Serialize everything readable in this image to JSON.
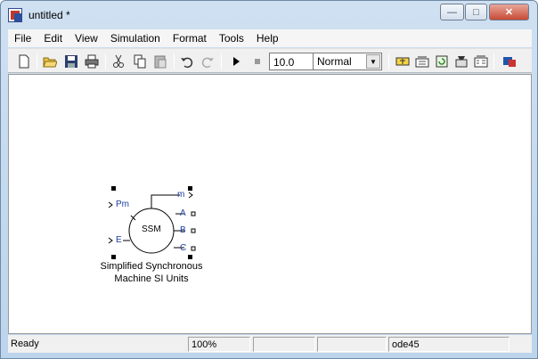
{
  "window": {
    "title": "untitled *",
    "minimize": "—",
    "maximize": "□",
    "close": "✕"
  },
  "menu": [
    "File",
    "Edit",
    "View",
    "Simulation",
    "Format",
    "Tools",
    "Help"
  ],
  "toolbar": {
    "stop_time": "10.0",
    "sim_mode": "Normal"
  },
  "block": {
    "name": "SSM",
    "label_line1": "Simplified Synchronous",
    "label_line2": "Machine SI Units",
    "inputs": [
      "Pm",
      "E"
    ],
    "outputs": [
      "m",
      "A",
      "B",
      "C"
    ]
  },
  "status": {
    "state": "Ready",
    "zoom": "100%",
    "solver": "ode45"
  }
}
